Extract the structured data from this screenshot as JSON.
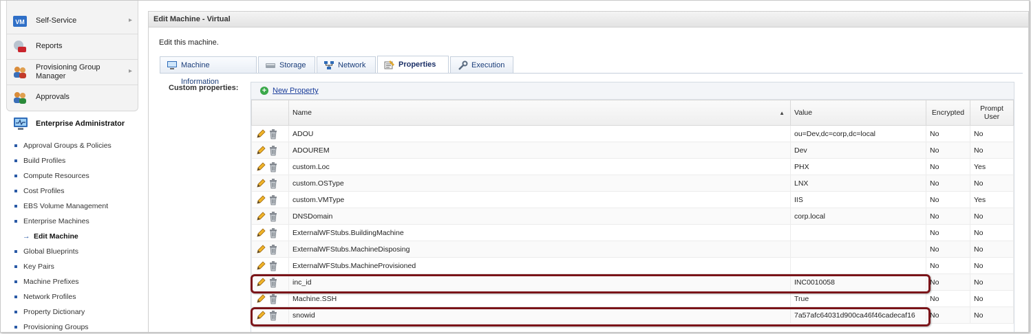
{
  "nav": {
    "top_items": [
      {
        "label": "Self-Service",
        "has_arrow": true,
        "icon": "vm-icon"
      },
      {
        "label": "Reports",
        "has_arrow": false,
        "icon": "reports-icon"
      },
      {
        "label": "Provisioning Group Manager",
        "has_arrow": true,
        "icon": "group-manager-icon"
      },
      {
        "label": "Approvals",
        "has_arrow": false,
        "icon": "approvals-icon"
      }
    ],
    "section_title": "Enterprise Administrator",
    "sub_items": [
      "Approval Groups & Policies",
      "Build Profiles",
      "Compute Resources",
      "Cost Profiles",
      "EBS Volume Management",
      "Enterprise Machines",
      "Edit Machine",
      "Global Blueprints",
      "Key Pairs",
      "Machine Prefixes",
      "Network Profiles",
      "Property Dictionary",
      "Provisioning Groups"
    ],
    "active_sub_item": "Edit Machine"
  },
  "panel": {
    "title": "Edit Machine - Virtual",
    "intro": "Edit this machine.",
    "tabs": [
      {
        "label": "Machine Information",
        "icon": "monitor-icon"
      },
      {
        "label": "Storage",
        "icon": "disk-icon"
      },
      {
        "label": "Network",
        "icon": "network-icon"
      },
      {
        "label": "Properties",
        "icon": "properties-icon"
      },
      {
        "label": "Execution",
        "icon": "wrench-icon"
      }
    ],
    "active_tab": "Properties",
    "custom_properties_label": "Custom properties:",
    "new_property_label": "New Property"
  },
  "grid": {
    "columns": [
      "Name",
      "Value",
      "Encrypted",
      "Prompt User"
    ],
    "sorted_column": "Name",
    "rows": [
      {
        "name": "ADOU",
        "value": "ou=Dev,dc=corp,dc=local",
        "encrypted": "No",
        "prompt": "No"
      },
      {
        "name": "ADOUREM",
        "value": "Dev",
        "encrypted": "No",
        "prompt": "No"
      },
      {
        "name": "custom.Loc",
        "value": "PHX",
        "encrypted": "No",
        "prompt": "Yes"
      },
      {
        "name": "custom.OSType",
        "value": "LNX",
        "encrypted": "No",
        "prompt": "No"
      },
      {
        "name": "custom.VMType",
        "value": "IIS",
        "encrypted": "No",
        "prompt": "Yes"
      },
      {
        "name": "DNSDomain",
        "value": "corp.local",
        "encrypted": "No",
        "prompt": "No"
      },
      {
        "name": "ExternalWFStubs.BuildingMachine",
        "value": "",
        "encrypted": "No",
        "prompt": "No"
      },
      {
        "name": "ExternalWFStubs.MachineDisposing",
        "value": "",
        "encrypted": "No",
        "prompt": "No"
      },
      {
        "name": "ExternalWFStubs.MachineProvisioned",
        "value": "",
        "encrypted": "No",
        "prompt": "No"
      },
      {
        "name": "inc_id",
        "value": "INC0010058",
        "encrypted": "No",
        "prompt": "No"
      },
      {
        "name": "Machine.SSH",
        "value": "True",
        "encrypted": "No",
        "prompt": "No"
      },
      {
        "name": "snowid",
        "value": "7a57afc64031d900ca46f46cadecaf16",
        "encrypted": "No",
        "prompt": "No"
      }
    ],
    "highlighted_rows": [
      "inc_id",
      "snowid"
    ],
    "highlight_color": "#7a1419"
  }
}
